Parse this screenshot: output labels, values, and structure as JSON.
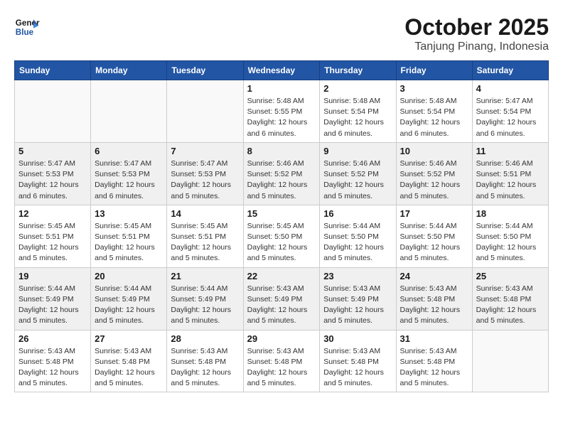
{
  "header": {
    "logo_line1": "General",
    "logo_line2": "Blue",
    "month": "October 2025",
    "location": "Tanjung Pinang, Indonesia"
  },
  "weekdays": [
    "Sunday",
    "Monday",
    "Tuesday",
    "Wednesday",
    "Thursday",
    "Friday",
    "Saturday"
  ],
  "weeks": [
    [
      {
        "day": "",
        "info": ""
      },
      {
        "day": "",
        "info": ""
      },
      {
        "day": "",
        "info": ""
      },
      {
        "day": "1",
        "info": "Sunrise: 5:48 AM\nSunset: 5:55 PM\nDaylight: 12 hours\nand 6 minutes."
      },
      {
        "day": "2",
        "info": "Sunrise: 5:48 AM\nSunset: 5:54 PM\nDaylight: 12 hours\nand 6 minutes."
      },
      {
        "day": "3",
        "info": "Sunrise: 5:48 AM\nSunset: 5:54 PM\nDaylight: 12 hours\nand 6 minutes."
      },
      {
        "day": "4",
        "info": "Sunrise: 5:47 AM\nSunset: 5:54 PM\nDaylight: 12 hours\nand 6 minutes."
      }
    ],
    [
      {
        "day": "5",
        "info": "Sunrise: 5:47 AM\nSunset: 5:53 PM\nDaylight: 12 hours\nand 6 minutes."
      },
      {
        "day": "6",
        "info": "Sunrise: 5:47 AM\nSunset: 5:53 PM\nDaylight: 12 hours\nand 6 minutes."
      },
      {
        "day": "7",
        "info": "Sunrise: 5:47 AM\nSunset: 5:53 PM\nDaylight: 12 hours\nand 5 minutes."
      },
      {
        "day": "8",
        "info": "Sunrise: 5:46 AM\nSunset: 5:52 PM\nDaylight: 12 hours\nand 5 minutes."
      },
      {
        "day": "9",
        "info": "Sunrise: 5:46 AM\nSunset: 5:52 PM\nDaylight: 12 hours\nand 5 minutes."
      },
      {
        "day": "10",
        "info": "Sunrise: 5:46 AM\nSunset: 5:52 PM\nDaylight: 12 hours\nand 5 minutes."
      },
      {
        "day": "11",
        "info": "Sunrise: 5:46 AM\nSunset: 5:51 PM\nDaylight: 12 hours\nand 5 minutes."
      }
    ],
    [
      {
        "day": "12",
        "info": "Sunrise: 5:45 AM\nSunset: 5:51 PM\nDaylight: 12 hours\nand 5 minutes."
      },
      {
        "day": "13",
        "info": "Sunrise: 5:45 AM\nSunset: 5:51 PM\nDaylight: 12 hours\nand 5 minutes."
      },
      {
        "day": "14",
        "info": "Sunrise: 5:45 AM\nSunset: 5:51 PM\nDaylight: 12 hours\nand 5 minutes."
      },
      {
        "day": "15",
        "info": "Sunrise: 5:45 AM\nSunset: 5:50 PM\nDaylight: 12 hours\nand 5 minutes."
      },
      {
        "day": "16",
        "info": "Sunrise: 5:44 AM\nSunset: 5:50 PM\nDaylight: 12 hours\nand 5 minutes."
      },
      {
        "day": "17",
        "info": "Sunrise: 5:44 AM\nSunset: 5:50 PM\nDaylight: 12 hours\nand 5 minutes."
      },
      {
        "day": "18",
        "info": "Sunrise: 5:44 AM\nSunset: 5:50 PM\nDaylight: 12 hours\nand 5 minutes."
      }
    ],
    [
      {
        "day": "19",
        "info": "Sunrise: 5:44 AM\nSunset: 5:49 PM\nDaylight: 12 hours\nand 5 minutes."
      },
      {
        "day": "20",
        "info": "Sunrise: 5:44 AM\nSunset: 5:49 PM\nDaylight: 12 hours\nand 5 minutes."
      },
      {
        "day": "21",
        "info": "Sunrise: 5:44 AM\nSunset: 5:49 PM\nDaylight: 12 hours\nand 5 minutes."
      },
      {
        "day": "22",
        "info": "Sunrise: 5:43 AM\nSunset: 5:49 PM\nDaylight: 12 hours\nand 5 minutes."
      },
      {
        "day": "23",
        "info": "Sunrise: 5:43 AM\nSunset: 5:49 PM\nDaylight: 12 hours\nand 5 minutes."
      },
      {
        "day": "24",
        "info": "Sunrise: 5:43 AM\nSunset: 5:48 PM\nDaylight: 12 hours\nand 5 minutes."
      },
      {
        "day": "25",
        "info": "Sunrise: 5:43 AM\nSunset: 5:48 PM\nDaylight: 12 hours\nand 5 minutes."
      }
    ],
    [
      {
        "day": "26",
        "info": "Sunrise: 5:43 AM\nSunset: 5:48 PM\nDaylight: 12 hours\nand 5 minutes."
      },
      {
        "day": "27",
        "info": "Sunrise: 5:43 AM\nSunset: 5:48 PM\nDaylight: 12 hours\nand 5 minutes."
      },
      {
        "day": "28",
        "info": "Sunrise: 5:43 AM\nSunset: 5:48 PM\nDaylight: 12 hours\nand 5 minutes."
      },
      {
        "day": "29",
        "info": "Sunrise: 5:43 AM\nSunset: 5:48 PM\nDaylight: 12 hours\nand 5 minutes."
      },
      {
        "day": "30",
        "info": "Sunrise: 5:43 AM\nSunset: 5:48 PM\nDaylight: 12 hours\nand 5 minutes."
      },
      {
        "day": "31",
        "info": "Sunrise: 5:43 AM\nSunset: 5:48 PM\nDaylight: 12 hours\nand 5 minutes."
      },
      {
        "day": "",
        "info": ""
      }
    ]
  ]
}
